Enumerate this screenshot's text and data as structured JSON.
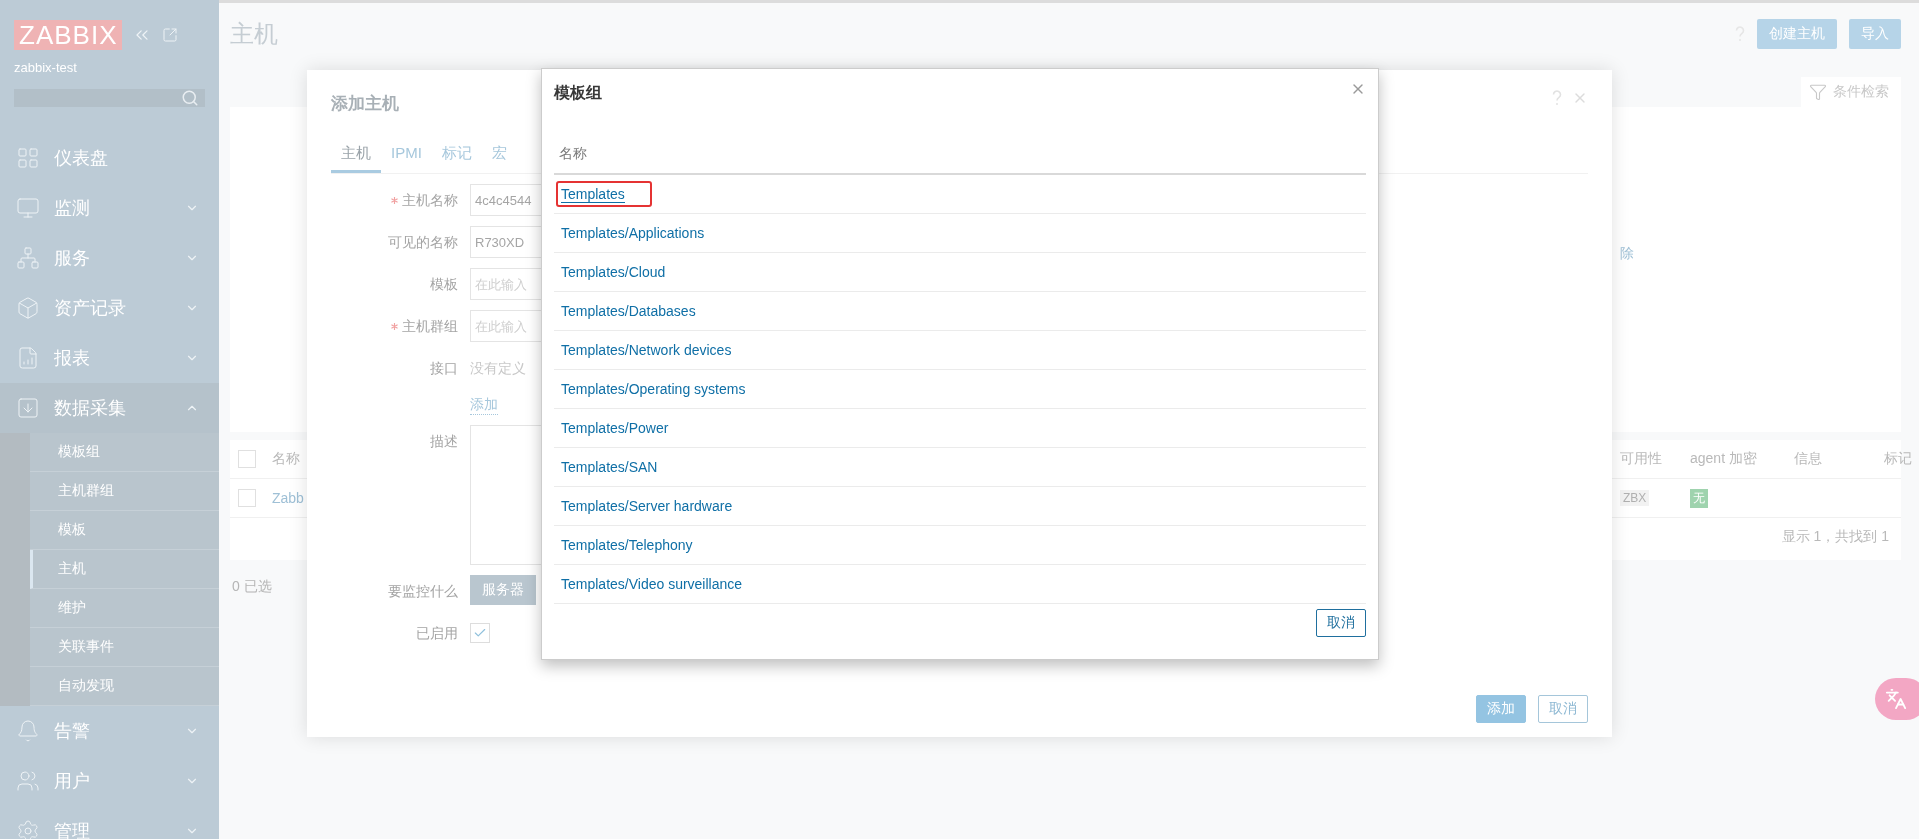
{
  "sidebar": {
    "logo": "ZABBIX",
    "server": "zabbix-test",
    "items": [
      {
        "label": "仪表盘"
      },
      {
        "label": "监测",
        "expanded": false
      },
      {
        "label": "服务",
        "expanded": false
      },
      {
        "label": "资产记录",
        "expanded": false
      },
      {
        "label": "报表",
        "expanded": false
      },
      {
        "label": "数据采集",
        "expanded": true,
        "children": [
          {
            "label": "模板组",
            "selected": false
          },
          {
            "label": "主机群组",
            "selected": false
          },
          {
            "label": "模板",
            "selected": false
          },
          {
            "label": "主机",
            "selected": true
          },
          {
            "label": "维护",
            "selected": false
          },
          {
            "label": "关联事件",
            "selected": false
          },
          {
            "label": "自动发现",
            "selected": false
          }
        ]
      },
      {
        "label": "告警",
        "expanded": false
      },
      {
        "label": "用户",
        "expanded": false
      },
      {
        "label": "管理",
        "expanded": false
      }
    ]
  },
  "page": {
    "title": "主机",
    "buttons": [
      "创建主机",
      "导入"
    ],
    "filter_tab": "条件检索",
    "filter_link": "除",
    "table": {
      "select_all_checked": false,
      "columns": [
        "名称",
        "可用性",
        "agent 加密",
        "信息",
        "标记"
      ],
      "rows": [
        {
          "checked": false,
          "name": "Zabb",
          "availability": "ZBX",
          "encryption": "无"
        }
      ]
    },
    "summary": "显示 1，共找到 1",
    "selected_count": "0 已选"
  },
  "dialog": {
    "title": "添加主机",
    "tabs": [
      {
        "label": "主机",
        "selected": true
      },
      {
        "label": "IPMI",
        "selected": false
      },
      {
        "label": "标记",
        "selected": false
      },
      {
        "label": "宏",
        "selected": false
      }
    ],
    "fields": [
      {
        "kind": "input",
        "label": "主机名称",
        "required": true,
        "value": "4c4c4544"
      },
      {
        "kind": "input",
        "label": "可见的名称",
        "required": false,
        "value": "R730XD"
      },
      {
        "kind": "input",
        "label": "模板",
        "required": false,
        "placeholder": "在此输入"
      },
      {
        "kind": "input",
        "label": "主机群组",
        "required": true,
        "placeholder": "在此输入"
      },
      {
        "kind": "text",
        "label": "接口",
        "required": false,
        "text": "没有定义",
        "link": "添加"
      },
      {
        "kind": "textarea",
        "label": "描述",
        "required": false
      },
      {
        "kind": "segmented",
        "label": "要监控什么",
        "required": false,
        "options": [
          "服务器"
        ]
      },
      {
        "kind": "checkbox",
        "label": "已启用",
        "required": false,
        "checked": true
      }
    ],
    "buttons": [
      "添加",
      "取消"
    ]
  },
  "modal": {
    "title": "模板组",
    "column": "名称",
    "rows": [
      {
        "label": "Templates",
        "highlighted": true
      },
      {
        "label": "Templates/Applications",
        "highlighted": false
      },
      {
        "label": "Templates/Cloud",
        "highlighted": false
      },
      {
        "label": "Templates/Databases",
        "highlighted": false
      },
      {
        "label": "Templates/Network devices",
        "highlighted": false
      },
      {
        "label": "Templates/Operating systems",
        "highlighted": false
      },
      {
        "label": "Templates/Power",
        "highlighted": false
      },
      {
        "label": "Templates/SAN",
        "highlighted": false
      },
      {
        "label": "Templates/Server hardware",
        "highlighted": false
      },
      {
        "label": "Templates/Telephony",
        "highlighted": false
      },
      {
        "label": "Templates/Video surveillance",
        "highlighted": false
      }
    ],
    "cancel": "取消"
  }
}
